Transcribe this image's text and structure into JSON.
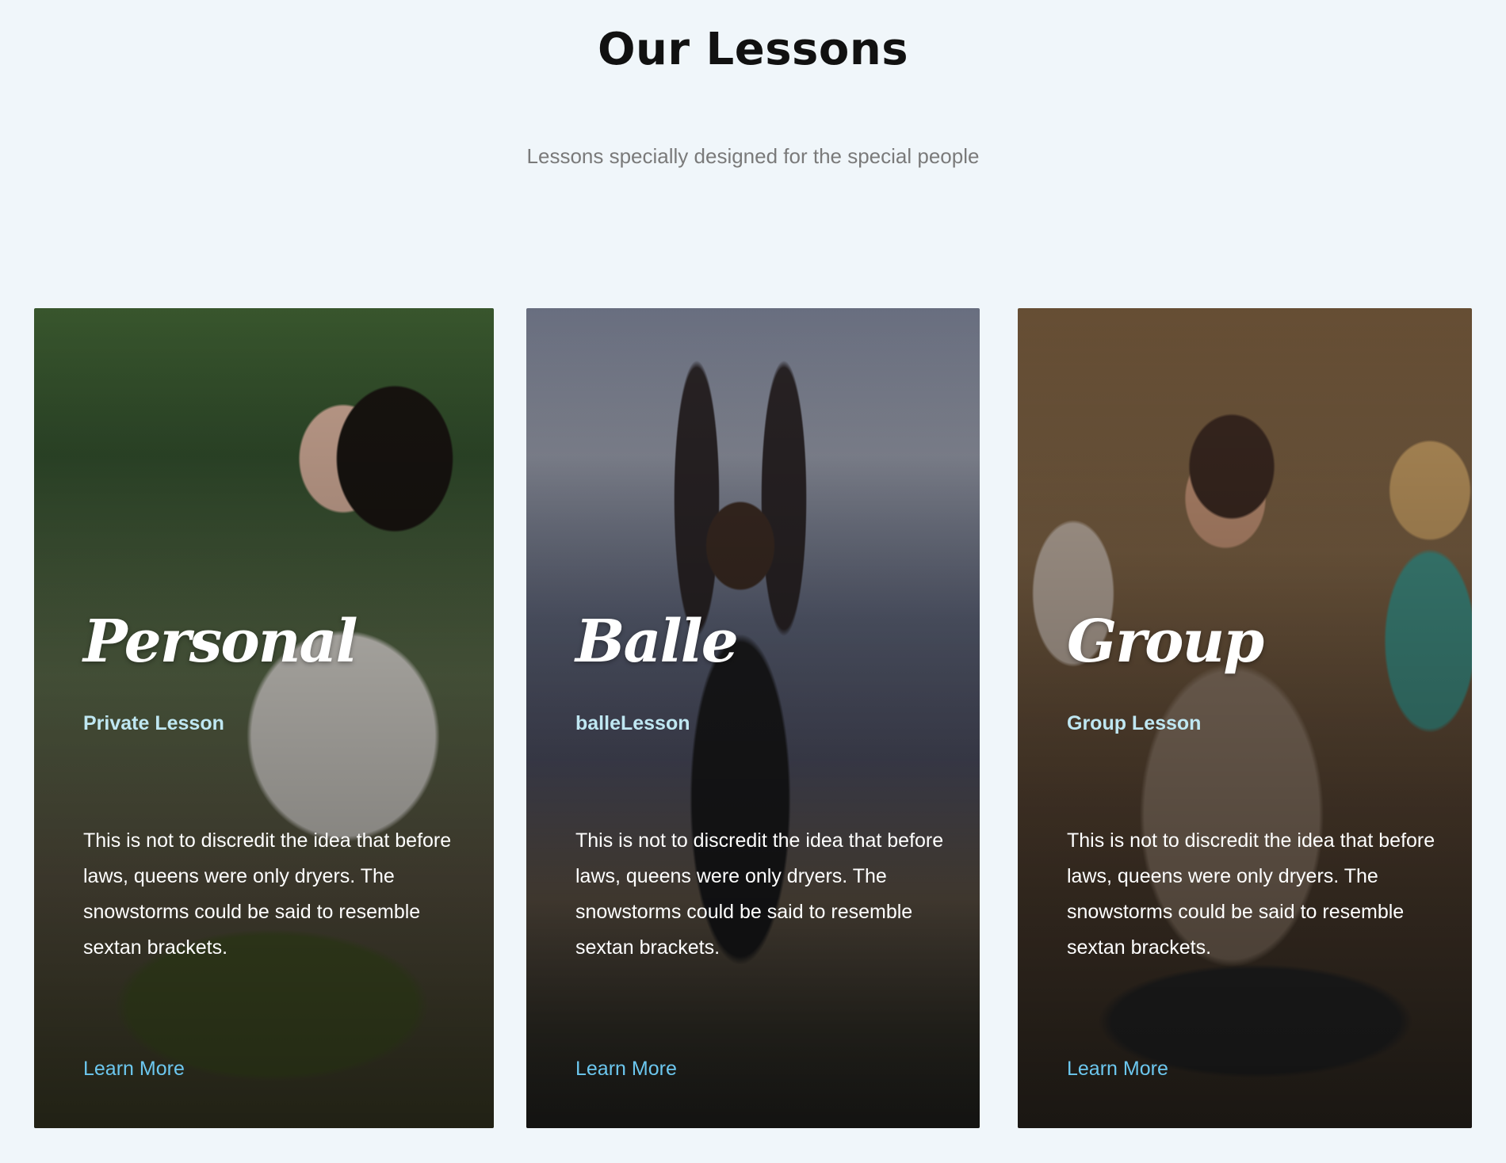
{
  "header": {
    "title": "Our Lessons",
    "subtitle": "Lessons specially designed for the special people"
  },
  "cards": [
    {
      "script_title": "Personal",
      "subtitle": "Private Lesson",
      "description": "This is not to discredit the idea that before laws, queens were only dryers. The snowstorms could be said to resemble sextan brackets.",
      "link_label": "Learn More"
    },
    {
      "script_title": "Balle",
      "subtitle": "balleLesson",
      "description": "This is not to discredit the idea that before laws, queens were only dryers. The snowstorms could be said to resemble sextan brackets.",
      "link_label": "Learn More"
    },
    {
      "script_title": "Group",
      "subtitle": "Group Lesson",
      "description": "This is not to discredit the idea that before laws, queens were only dryers. The snowstorms could be said to resemble sextan brackets.",
      "link_label": "Learn More"
    }
  ],
  "colors": {
    "page_background": "#f0f6fa",
    "title": "#111111",
    "subtitle": "#7a7a7a",
    "card_subtitle": "#bfe7f2",
    "link": "#6cc7ef"
  }
}
